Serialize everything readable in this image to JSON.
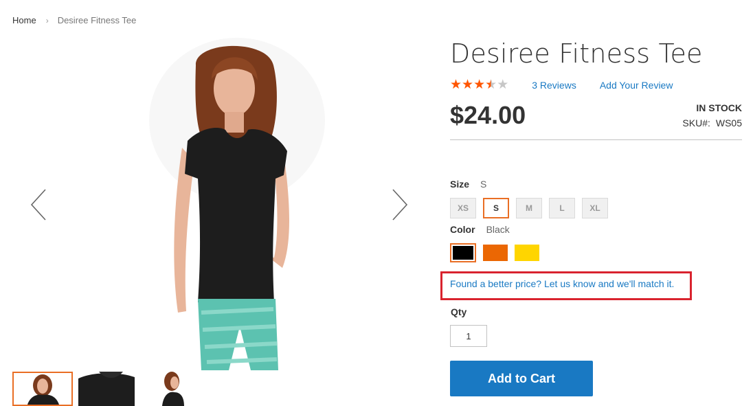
{
  "breadcrumbs": {
    "home": "Home",
    "current": "Desiree Fitness Tee"
  },
  "gallery": {
    "prev_icon": "chevron-left-icon",
    "next_icon": "chevron-right-icon",
    "thumbnails": 3,
    "active_thumbnail": 1
  },
  "product": {
    "title": "Desiree Fitness Tee",
    "rating_fraction": 0.7,
    "reviews_link": "3 Reviews",
    "add_review_link": "Add Your Review",
    "price": "$24.00",
    "stock": "IN STOCK",
    "sku_label": "SKU#:",
    "sku": "WS05"
  },
  "options": {
    "size_label": "Size",
    "size_selected": "S",
    "sizes": [
      "XS",
      "S",
      "M",
      "L",
      "XL"
    ],
    "color_label": "Color",
    "color_selected": "Black",
    "colors": [
      {
        "name": "Black",
        "hex": "#000000"
      },
      {
        "name": "Orange",
        "hex": "#eb6703"
      },
      {
        "name": "Yellow",
        "hex": "#ffd500"
      }
    ]
  },
  "price_match": {
    "link": "Found a better price? Let us know and we'll match it.",
    "highlight_color": "#d9232e"
  },
  "cart": {
    "qty_label": "Qty",
    "qty_value": "1",
    "add_button": "Add to Cart",
    "button_color": "#1979c3"
  },
  "colors": {
    "accent": "#e96e24",
    "link": "#1979c3",
    "star": "#ff5501"
  }
}
